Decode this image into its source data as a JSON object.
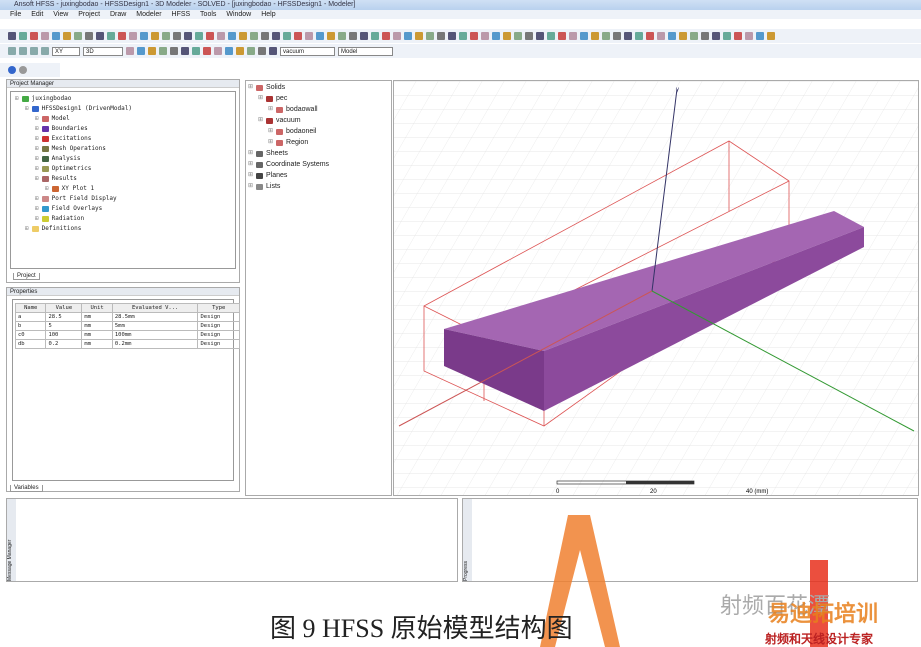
{
  "window": {
    "title": "Ansoft HFSS - juxingbodao - HFSSDesign1 - 3D Modeler - SOLVED - [juxingbodao - HFSSDesign1 - Modeler]"
  },
  "menu": [
    "File",
    "Edit",
    "View",
    "Project",
    "Draw",
    "Modeler",
    "HFSS",
    "Tools",
    "Window",
    "Help"
  ],
  "toolbar": {
    "plane_select": "XY",
    "dim_select": "3D",
    "material_select": "vacuum",
    "mode_select": "Model"
  },
  "project_manager": {
    "title": "Project Manager",
    "tab": "Project",
    "items": [
      {
        "label": "juxingbodao",
        "level": 0,
        "color": "#4a4"
      },
      {
        "label": "HFSSDesign1 (DrivenModal)",
        "level": 1,
        "color": "#36c"
      },
      {
        "label": "Model",
        "level": 2,
        "color": "#c66"
      },
      {
        "label": "Boundaries",
        "level": 2,
        "color": "#63a"
      },
      {
        "label": "Excitations",
        "level": 2,
        "color": "#c33"
      },
      {
        "label": "Mesh Operations",
        "level": 2,
        "color": "#774"
      },
      {
        "label": "Analysis",
        "level": 2,
        "color": "#464"
      },
      {
        "label": "Optimetrics",
        "level": 2,
        "color": "#995"
      },
      {
        "label": "Results",
        "level": 2,
        "color": "#a66"
      },
      {
        "label": "XY Plot 1",
        "level": 3,
        "color": "#c63"
      },
      {
        "label": "Port Field Display",
        "level": 2,
        "color": "#c88"
      },
      {
        "label": "Field Overlays",
        "level": 2,
        "color": "#39c"
      },
      {
        "label": "Radiation",
        "level": 2,
        "color": "#cc3"
      },
      {
        "label": "Definitions",
        "level": 1,
        "color": "#ec6"
      }
    ]
  },
  "properties": {
    "title": "Properties",
    "tab": "Variables",
    "columns": [
      "Name",
      "Value",
      "Unit",
      "Evaluated V...",
      "Type"
    ],
    "rows": [
      [
        "a",
        "28.5",
        "mm",
        "28.5mm",
        "Design"
      ],
      [
        "b",
        "5",
        "mm",
        "5mm",
        "Design"
      ],
      [
        "c0",
        "100",
        "mm",
        "100mm",
        "Design"
      ],
      [
        "db",
        "0.2",
        "mm",
        "0.2mm",
        "Design"
      ]
    ]
  },
  "model_tree": {
    "items": [
      {
        "label": "Solids",
        "level": 0,
        "color": "#c66"
      },
      {
        "label": "pec",
        "level": 1,
        "color": "#a33"
      },
      {
        "label": "bodaowall",
        "level": 2,
        "color": "#c66"
      },
      {
        "label": "vacuum",
        "level": 1,
        "color": "#a33"
      },
      {
        "label": "bodaoneil",
        "level": 2,
        "color": "#c66"
      },
      {
        "label": "Region",
        "level": 2,
        "color": "#c66"
      },
      {
        "label": "Sheets",
        "level": 0,
        "color": "#666"
      },
      {
        "label": "Coordinate Systems",
        "level": 0,
        "color": "#666"
      },
      {
        "label": "Planes",
        "level": 0,
        "color": "#444"
      },
      {
        "label": "Lists",
        "level": 0,
        "color": "#888"
      }
    ]
  },
  "viewport": {
    "axis_label": "y",
    "scale": [
      "0",
      "20",
      "40 (mm)"
    ],
    "box_color": "#9b4fa8"
  },
  "bottom": {
    "left_label": "Message Manager",
    "right_label": "Progress"
  },
  "caption": "图 9 HFSS 原始模型结构图",
  "watermark": {
    "text1": "射频百花潭",
    "text2": "易迪拓培训",
    "text3": "射频和天线设计专家"
  }
}
